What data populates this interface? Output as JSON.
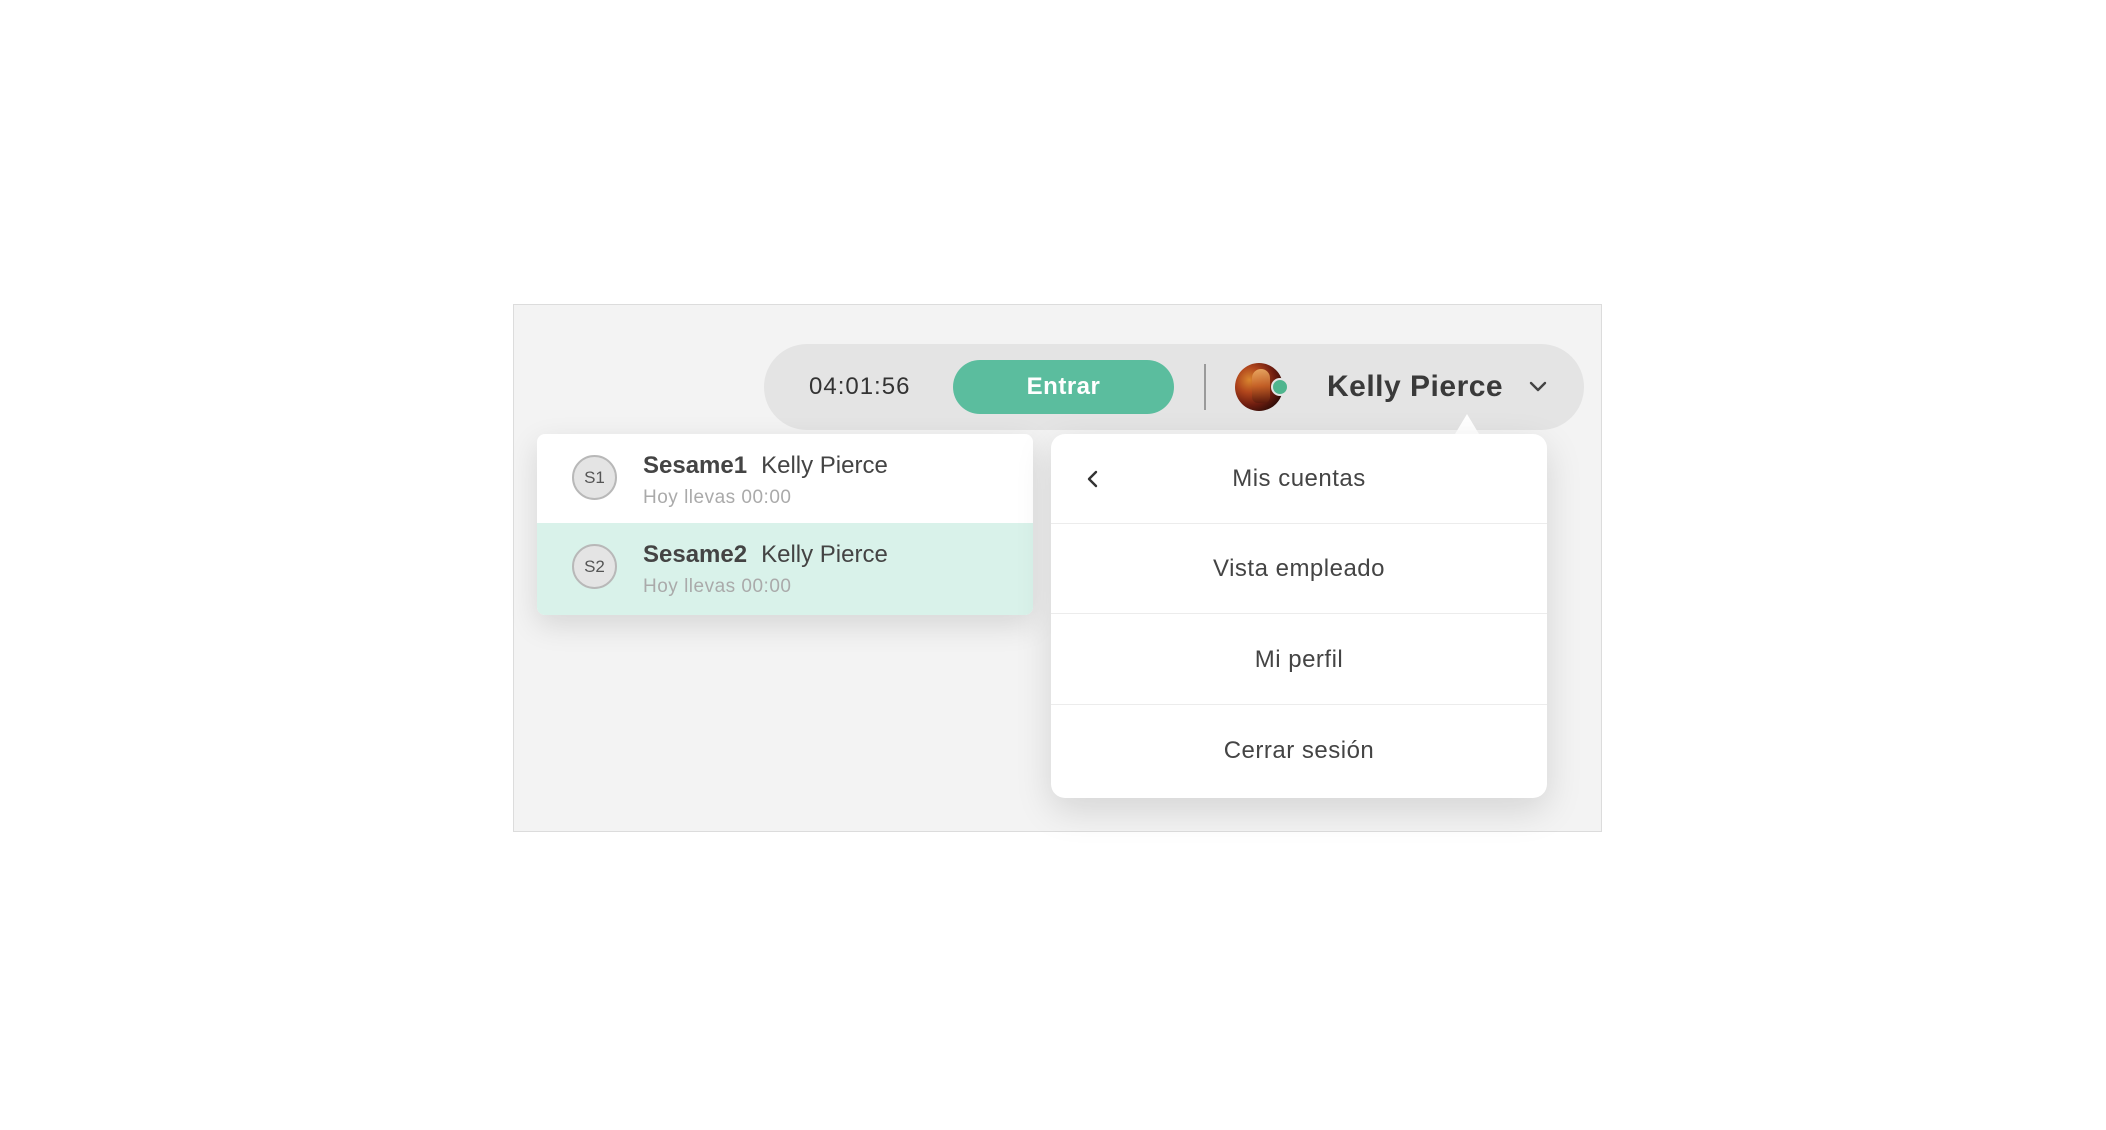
{
  "header": {
    "timer": "04:01:56",
    "enter_label": "Entrar",
    "user_name": "Kelly Pierce",
    "avatar_icon": "user-avatar-photo",
    "status_color": "#4fb58e",
    "dropdown_icon": "chevron-down-icon"
  },
  "accounts": {
    "items": [
      {
        "initials": "S1",
        "company": "Sesame1",
        "user": "Kelly Pierce",
        "subtitle": "Hoy llevas 00:00",
        "selected": false
      },
      {
        "initials": "S2",
        "company": "Sesame2",
        "user": "Kelly Pierce",
        "subtitle": "Hoy llevas 00:00",
        "selected": true
      }
    ]
  },
  "menu": {
    "back_icon": "chevron-left-icon",
    "items": [
      {
        "label": "Mis cuentas"
      },
      {
        "label": "Vista empleado"
      },
      {
        "label": "Mi perfil"
      },
      {
        "label": "Cerrar sesión"
      }
    ]
  },
  "colors": {
    "accent": "#5bbd9e",
    "selected_row": "#d9f2ea",
    "background_panel": "#f3f3f3",
    "header_pill": "#e4e4e4"
  }
}
